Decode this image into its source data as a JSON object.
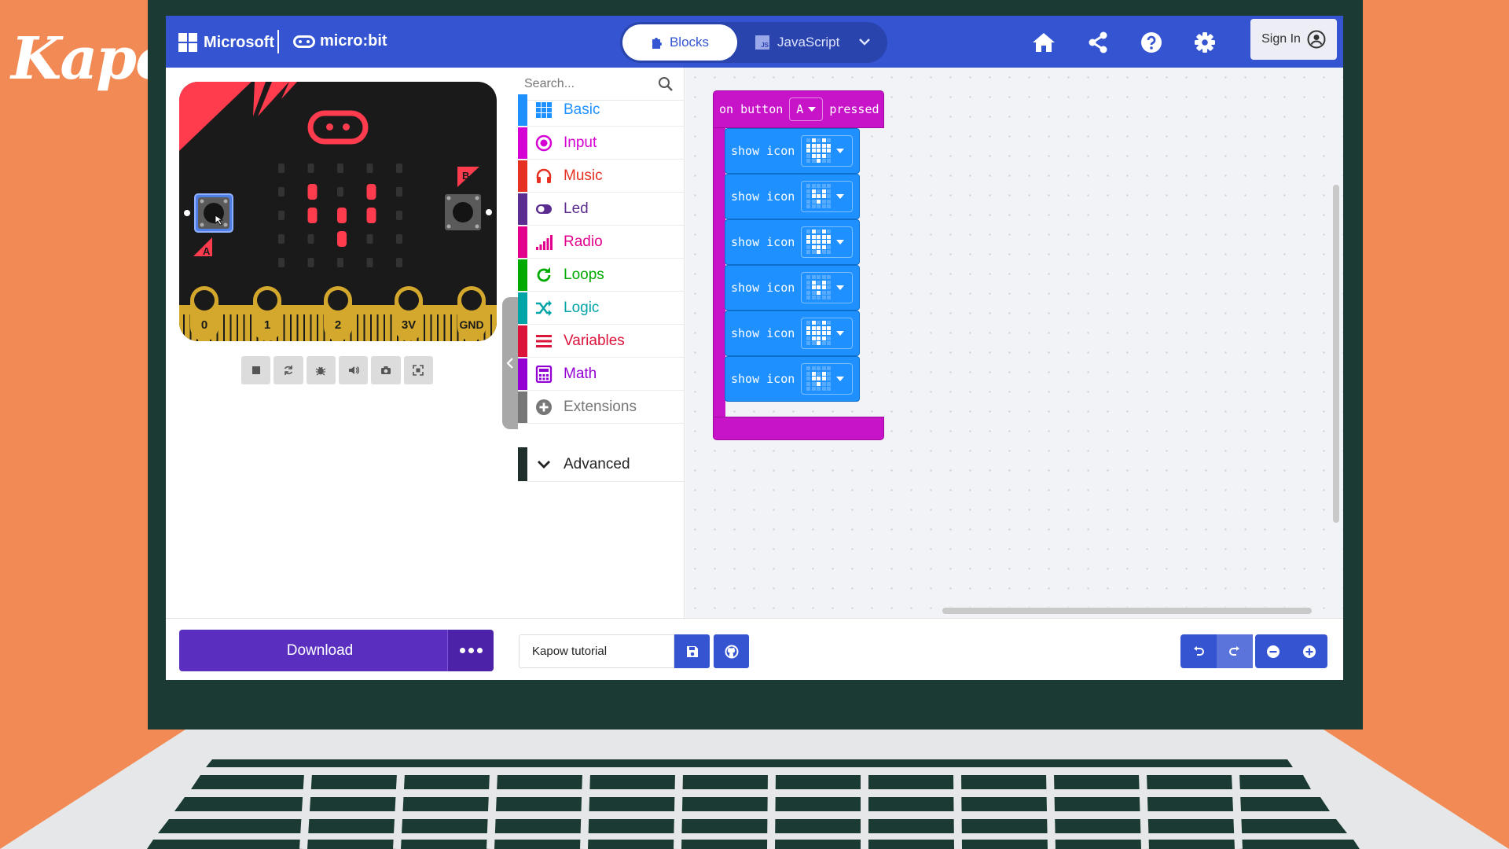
{
  "backdrop": {
    "brand": "Kapow",
    "brand_mark": "™"
  },
  "header": {
    "microsoft_label": "Microsoft",
    "product_label": "micro:bit",
    "mode_blocks": "Blocks",
    "mode_js": "JavaScript",
    "js_badge": "JS",
    "sign_in": "Sign In",
    "accent": "#3454d1"
  },
  "simulator": {
    "pins": [
      "0",
      "1",
      "2",
      "3V",
      "GND"
    ],
    "button_a": "A",
    "button_b": "B",
    "led_color": "#ff3b4e",
    "board_color": "#1a1a1a",
    "edge_color": "#d4a82c"
  },
  "toolbox": {
    "search_placeholder": "Search...",
    "categories": [
      {
        "label": "Basic",
        "icon": "grid-icon",
        "color": "#1e90ff"
      },
      {
        "label": "Input",
        "icon": "target-icon",
        "color": "#d400d4"
      },
      {
        "label": "Music",
        "icon": "headphones-icon",
        "color": "#e63022"
      },
      {
        "label": "Led",
        "icon": "toggle-icon",
        "color": "#5c2d91"
      },
      {
        "label": "Radio",
        "icon": "signal-bars-icon",
        "color": "#e3008c"
      },
      {
        "label": "Loops",
        "icon": "loop-arrow-icon",
        "color": "#00aa00"
      },
      {
        "label": "Logic",
        "icon": "shuffle-icon",
        "color": "#00a4a6"
      },
      {
        "label": "Variables",
        "icon": "list-icon",
        "color": "#dc143c"
      },
      {
        "label": "Math",
        "icon": "calculator-icon",
        "color": "#9400d3"
      },
      {
        "label": "Extensions",
        "icon": "plus-circle-icon",
        "color": "#777777"
      }
    ],
    "advanced": "Advanced"
  },
  "workspace": {
    "event_block": {
      "prefix": "on button",
      "button": "A",
      "suffix": "pressed",
      "color": "#c814c8"
    },
    "show_blocks": [
      {
        "label": "show icon",
        "icon": "heart-large"
      },
      {
        "label": "show icon",
        "icon": "heart-small"
      },
      {
        "label": "show icon",
        "icon": "heart-large"
      },
      {
        "label": "show icon",
        "icon": "heart-small"
      },
      {
        "label": "show icon",
        "icon": "heart-large"
      },
      {
        "label": "show icon",
        "icon": "heart-small"
      }
    ],
    "block_color": "#1e90ff"
  },
  "footer": {
    "download": "Download",
    "project_name": "Kapow tutorial",
    "download_color": "#5a2fbf"
  }
}
